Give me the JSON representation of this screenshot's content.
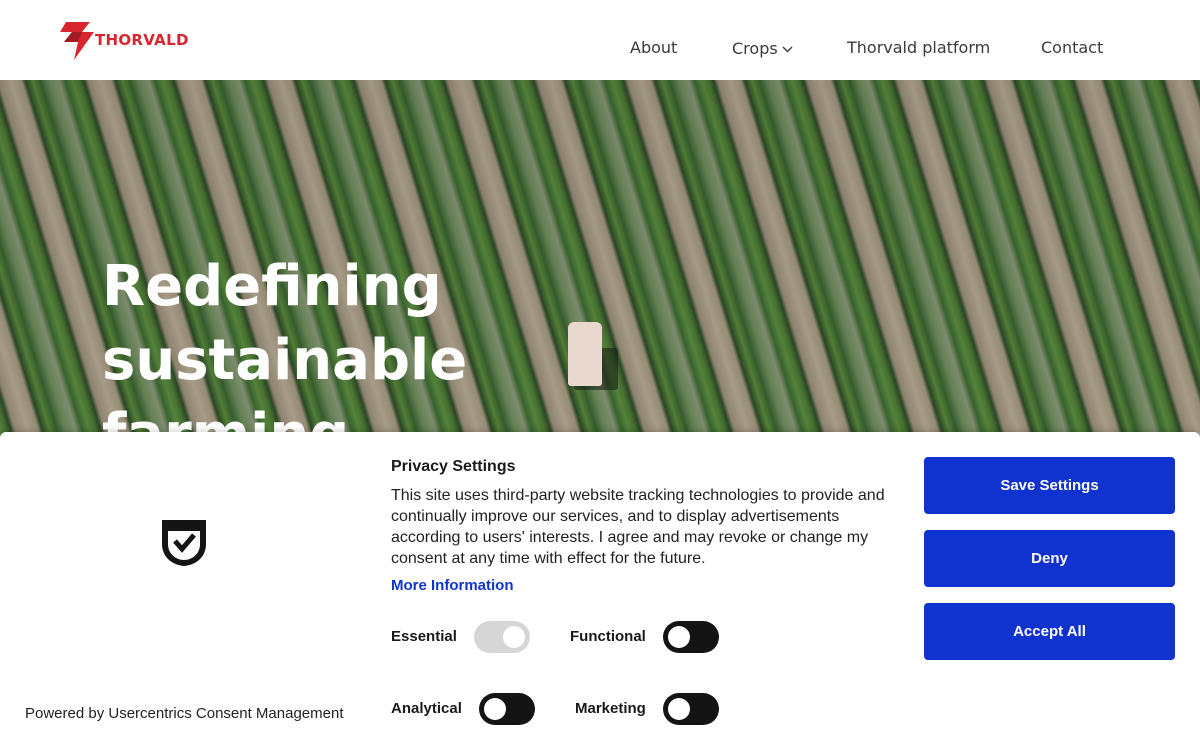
{
  "header": {
    "logo_text": "THORVALD",
    "nav": {
      "about": "About",
      "crops": "Crops",
      "platform": "Thorvald platform",
      "contact": "Contact"
    }
  },
  "hero": {
    "title": "Redefining sustainable farming"
  },
  "consent": {
    "title": "Privacy Settings",
    "text": "This site uses third-party website tracking technologies to provide and continually improve our services, and to display advertisements according to users' interests. I agree and may revoke or change my consent at any time with effect for the future.",
    "more_info": "More Information",
    "powered_by": "Powered by Usercentrics Consent Management",
    "toggles": {
      "essential": {
        "label": "Essential",
        "state": "on, disabled"
      },
      "functional": {
        "label": "Functional",
        "state": "off"
      },
      "analytical": {
        "label": "Analytical",
        "state": "off"
      },
      "marketing": {
        "label": "Marketing",
        "state": "off"
      }
    },
    "buttons": {
      "save": "Save Settings",
      "deny": "Deny",
      "accept": "Accept All"
    }
  },
  "colors": {
    "brand_red": "#d7262e",
    "button_blue": "#1032cf",
    "link_blue": "#0f36c9",
    "toggle_dark": "#141414"
  },
  "icons": {
    "logo_mark": "thorvald-bolt-icon",
    "consent_shield": "shield-check-icon",
    "crops_dropdown": "chevron-down-icon"
  }
}
